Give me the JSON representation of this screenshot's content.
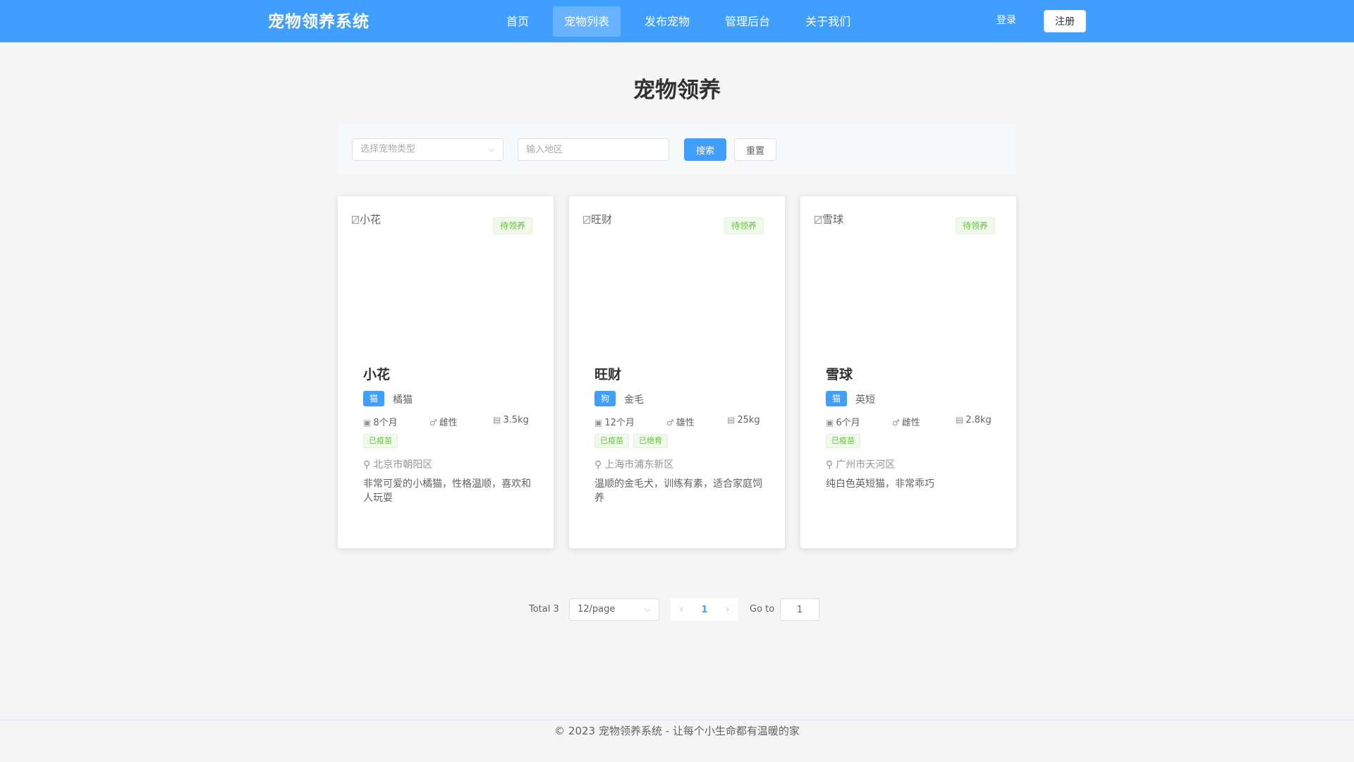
{
  "header": {
    "brand": "宠物领养系统",
    "nav": [
      "首页",
      "宠物列表",
      "发布宠物",
      "管理后台",
      "关于我们"
    ],
    "login": "登录",
    "register": "注册"
  },
  "page_title": "宠物领养",
  "search": {
    "type_placeholder": "选择宠物类型",
    "region_placeholder": "输入地区",
    "search_label": "搜索",
    "reset_label": "重置"
  },
  "pets": [
    {
      "img_alt": "小花",
      "status": "待领养",
      "name": "小花",
      "type": "猫",
      "breed": "橘猫",
      "age": "8个月",
      "gender": "雌性",
      "weight": "3.5kg",
      "tags": [
        "已疫苗"
      ],
      "location": "北京市朝阳区",
      "description": "非常可爱的小橘猫，性格温顺，喜欢和人玩耍"
    },
    {
      "img_alt": "旺财",
      "status": "待领养",
      "name": "旺财",
      "type": "狗",
      "breed": "金毛",
      "age": "12个月",
      "gender": "雄性",
      "weight": "25kg",
      "tags": [
        "已疫苗",
        "已绝育"
      ],
      "location": "上海市浦东新区",
      "description": "温顺的金毛犬，训练有素，适合家庭饲养"
    },
    {
      "img_alt": "雪球",
      "status": "待领养",
      "name": "雪球",
      "type": "猫",
      "breed": "英短",
      "age": "6个月",
      "gender": "雌性",
      "weight": "2.8kg",
      "tags": [
        "已疫苗"
      ],
      "location": "广州市天河区",
      "description": "纯白色英短猫，非常乖巧"
    }
  ],
  "pagination": {
    "total": "Total 3",
    "page_size": "12/page",
    "current_page": "1",
    "goto_label": "Go to",
    "goto_value": "1"
  },
  "footer": "© 2023 宠物领养系统 - 让每个小生命都有温暖的家",
  "colors": {
    "primary": "#409eff",
    "success": "#67c23a"
  }
}
